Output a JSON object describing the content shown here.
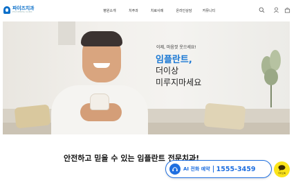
{
  "header": {
    "logo_text": "파이즈치과",
    "logo_sub": "PYIZ DENTAL CLINIC",
    "nav": [
      "병원소개",
      "치주과",
      "치료사례",
      "온라인상담",
      "커뮤니티"
    ],
    "icons": [
      "search-icon",
      "user-icon",
      "bag-icon",
      "menu-icon"
    ]
  },
  "hero": {
    "small_text": "이제, 마음껏 웃으세요!",
    "line1": "임플란트,",
    "line2": "더이상",
    "line3": "미루지마세요"
  },
  "section_title": "안전하고 믿을 수 있는 임플란트 전문치과!",
  "floating": {
    "ai_label": "AI 전화 예약",
    "phone": "1555-3459",
    "kakao_label": "카카오톡",
    "accent": "#1f6fe0",
    "kakao_color": "#fbe41a"
  }
}
